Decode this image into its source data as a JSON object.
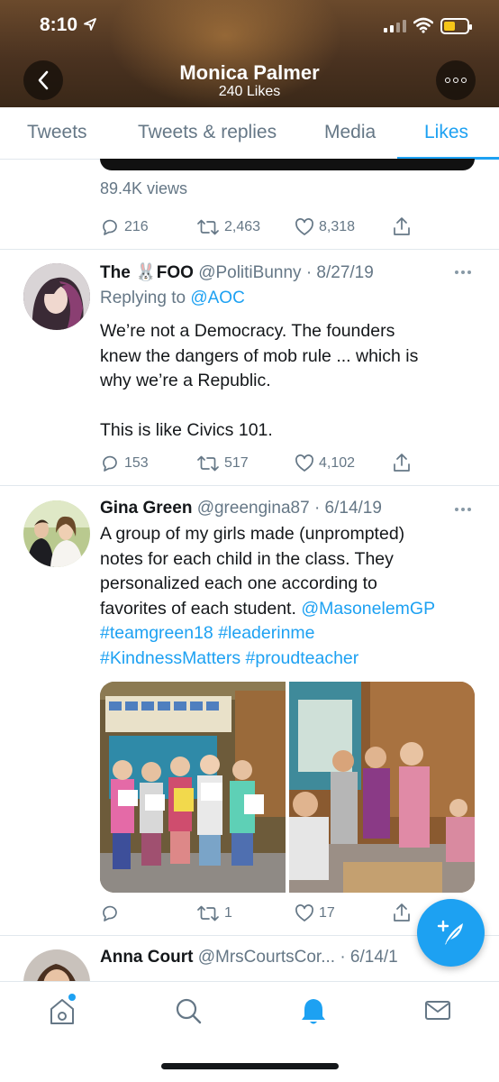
{
  "status_bar": {
    "time": "8:10"
  },
  "header": {
    "name": "Monica Palmer",
    "likes_count": "240 Likes"
  },
  "tabs": [
    {
      "label": "Tweets",
      "active": false
    },
    {
      "label": "Tweets & replies",
      "active": false
    },
    {
      "label": "Media",
      "active": false
    },
    {
      "label": "Likes",
      "active": true
    }
  ],
  "tweet0": {
    "views": "89.4K views",
    "replies": "216",
    "retweets": "2,463",
    "likes": "8,318"
  },
  "tweet1": {
    "name_prefix": "The",
    "name_emoji": "🐰",
    "name_suffix": "FOO",
    "handle": "@PolitiBunny",
    "date": "· 8/27/19",
    "replying_label": "Replying to",
    "replying_handle": "@AOC",
    "line1": "We’re not a Democracy. The founders",
    "line2": "knew the dangers of mob rule ... which is",
    "line3": "why we’re a Republic.",
    "line4": "This is like Civics 101.",
    "replies": "153",
    "retweets": "517",
    "likes": "4,102"
  },
  "tweet2": {
    "name": "Gina Green",
    "handle": "@greengina87",
    "date": "· 6/14/19",
    "line1": "A group of my girls made (unprompted)",
    "line2": "notes for each child in the class. They",
    "line3": "personalized each one according to",
    "line4_text": "favorites of each student.",
    "line4_link": "@MasonelemGP",
    "line5a": "#teamgreen18",
    "line5b": "#leaderinme",
    "line6a": "#KindnessMatters",
    "line6b": "#proudteacher",
    "replies": "",
    "retweets": "1",
    "likes": "17"
  },
  "tweet3": {
    "name": "Anna Court",
    "handle": "@MrsCourtsCor...",
    "date": "· 6/14/1"
  },
  "colors": {
    "accent": "#1da1f2",
    "secondary_text": "#657786",
    "divider": "#e1e8ed"
  },
  "icons": [
    "back-arrow-icon",
    "more-icon",
    "reply-icon",
    "retweet-icon",
    "like-icon",
    "share-icon",
    "compose-icon",
    "home-icon",
    "search-icon",
    "notifications-icon",
    "messages-icon"
  ]
}
